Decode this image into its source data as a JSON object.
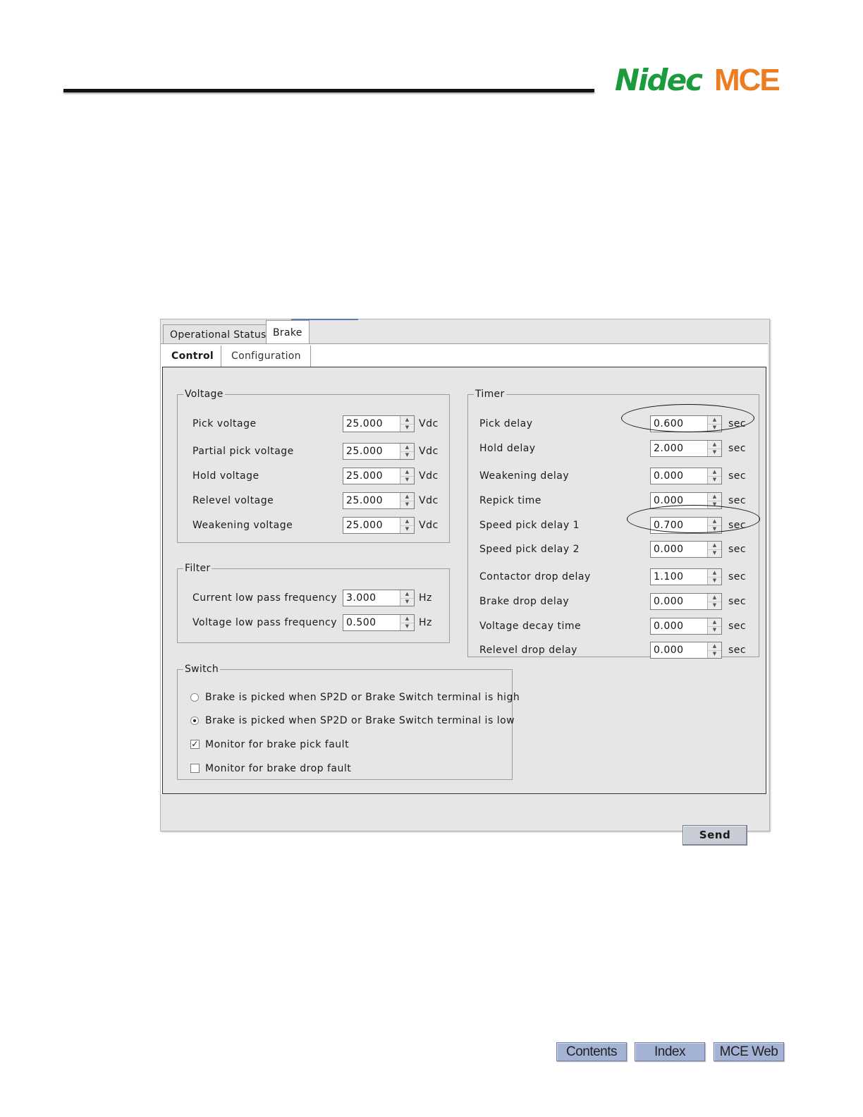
{
  "header": {
    "logo_nidec": "Nidec",
    "logo_mce": "MCE",
    "colors": {
      "nidec_green": "#1c9b3c",
      "mce_orange": "#ee7d21"
    }
  },
  "window": {
    "tabs": [
      {
        "label": "Operational Status",
        "active": false
      },
      {
        "label": "Brake",
        "active": true
      }
    ],
    "subtabs": [
      {
        "label": "Control",
        "active": true
      },
      {
        "label": "Configuration",
        "active": false
      }
    ],
    "voltage": {
      "legend": "Voltage",
      "rows": [
        {
          "label": "Pick voltage",
          "value": "25.000",
          "unit": "Vdc"
        },
        {
          "label": "Partial pick voltage",
          "value": "25.000",
          "unit": "Vdc"
        },
        {
          "label": "Hold voltage",
          "value": "25.000",
          "unit": "Vdc"
        },
        {
          "label": "Relevel voltage",
          "value": "25.000",
          "unit": "Vdc"
        },
        {
          "label": "Weakening voltage",
          "value": "25.000",
          "unit": "Vdc"
        }
      ]
    },
    "filter": {
      "legend": "Filter",
      "rows": [
        {
          "label": "Current low pass frequency",
          "value": "3.000",
          "unit": "Hz"
        },
        {
          "label": "Voltage low pass frequency",
          "value": "0.500",
          "unit": "Hz"
        }
      ]
    },
    "timer": {
      "legend": "Timer",
      "rows": [
        {
          "label": "Pick delay",
          "value": "0.600",
          "unit": "sec",
          "circled": true
        },
        {
          "label": "Hold delay",
          "value": "2.000",
          "unit": "sec"
        },
        {
          "label": "Weakening delay",
          "value": "0.000",
          "unit": "sec"
        },
        {
          "label": "Repick time",
          "value": "0.000",
          "unit": "sec"
        },
        {
          "label": "Speed pick delay 1",
          "value": "0.700",
          "unit": "sec",
          "circled": true
        },
        {
          "label": "Speed pick delay 2",
          "value": "0.000",
          "unit": "sec"
        },
        {
          "label": "Contactor drop delay",
          "value": "1.100",
          "unit": "sec"
        },
        {
          "label": "Brake drop delay",
          "value": "0.000",
          "unit": "sec"
        },
        {
          "label": "Voltage decay time",
          "value": "0.000",
          "unit": "sec"
        },
        {
          "label": "Relevel drop delay",
          "value": "0.000",
          "unit": "sec"
        }
      ]
    },
    "switch": {
      "legend": "Switch",
      "options": [
        {
          "type": "radio",
          "label": "Brake is picked when SP2D or Brake Switch terminal is high",
          "checked": false
        },
        {
          "type": "radio",
          "label": "Brake is picked when SP2D or Brake Switch terminal is low",
          "checked": true
        },
        {
          "type": "checkbox",
          "label": "Monitor for brake pick fault",
          "checked": true
        },
        {
          "type": "checkbox",
          "label": "Monitor for brake drop fault",
          "checked": false
        }
      ]
    },
    "send_label": "Send"
  },
  "footer_nav": [
    {
      "label": "Contents"
    },
    {
      "label": "Index"
    },
    {
      "label": "MCE Web"
    }
  ]
}
